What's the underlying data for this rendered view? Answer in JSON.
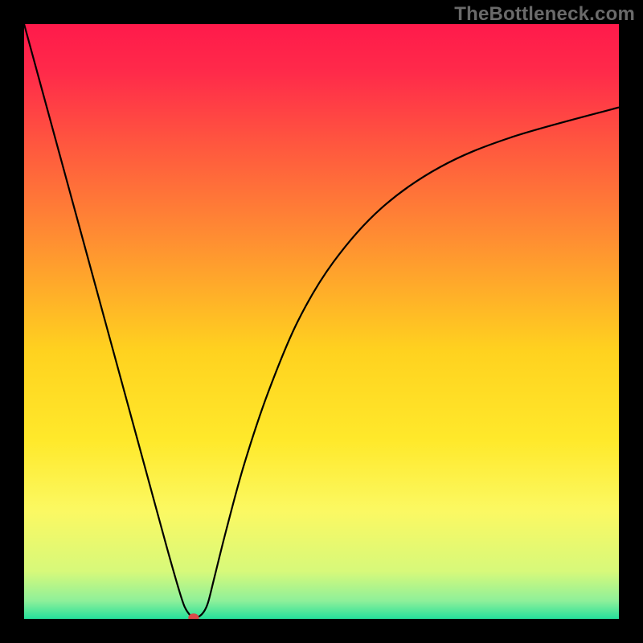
{
  "watermark": "TheBottleneck.com",
  "chart_data": {
    "type": "line",
    "title": "",
    "xlabel": "",
    "ylabel": "",
    "xlim": [
      0,
      100
    ],
    "ylim": [
      0,
      100
    ],
    "grid": false,
    "legend": false,
    "background": {
      "kind": "vertical-gradient",
      "stops": [
        {
          "offset": 0.0,
          "color": "#ff1a4b"
        },
        {
          "offset": 0.08,
          "color": "#ff2a4a"
        },
        {
          "offset": 0.2,
          "color": "#ff563f"
        },
        {
          "offset": 0.35,
          "color": "#ff8a33"
        },
        {
          "offset": 0.55,
          "color": "#ffd21f"
        },
        {
          "offset": 0.7,
          "color": "#ffe92b"
        },
        {
          "offset": 0.82,
          "color": "#fbf963"
        },
        {
          "offset": 0.92,
          "color": "#d7f97a"
        },
        {
          "offset": 0.97,
          "color": "#8df09a"
        },
        {
          "offset": 1.0,
          "color": "#25e09b"
        }
      ]
    },
    "series": [
      {
        "name": "bottleneck-curve",
        "color": "#000000",
        "x": [
          0,
          3,
          6,
          9,
          12,
          15,
          18,
          21,
          24,
          26,
          27,
          28,
          28.5,
          29.2,
          29.8,
          30.4,
          31,
          32,
          34,
          37,
          41,
          46,
          52,
          60,
          70,
          82,
          100
        ],
        "y": [
          100,
          89,
          78,
          67,
          56,
          45,
          34,
          23,
          12,
          5,
          2,
          0.5,
          0.2,
          0.3,
          0.7,
          1.5,
          3,
          7,
          15,
          26,
          38,
          50,
          60,
          69,
          76,
          81,
          86
        ]
      }
    ],
    "marker": {
      "name": "optimal-point",
      "x": 28.5,
      "y": 0.2,
      "color": "#d94a4a",
      "radius_pct": 0.9
    }
  }
}
